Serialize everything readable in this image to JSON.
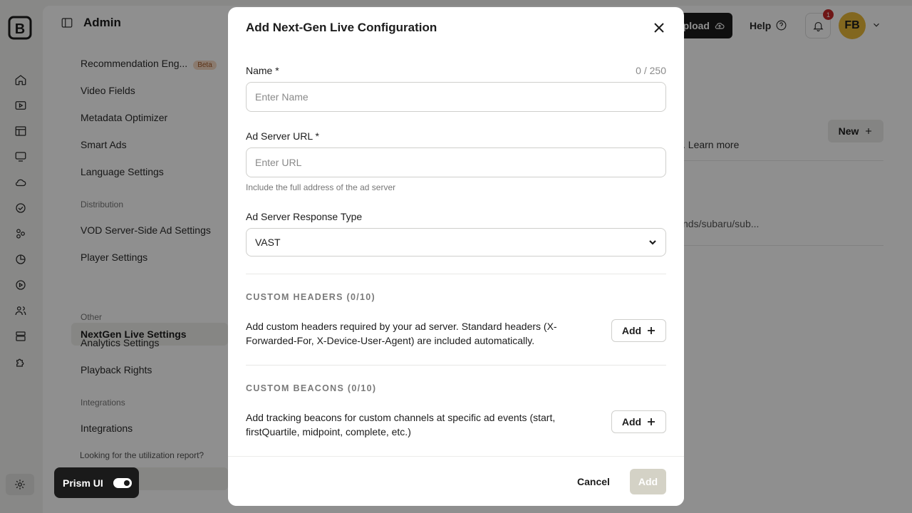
{
  "app": {
    "title": "Admin",
    "upload_label": "Upload",
    "help_label": "Help",
    "notification_count": "1",
    "avatar_initials": "FB",
    "new_label": "New",
    "learn_more_text": ". Learn more",
    "bg_url_fragment": "nds/subaru/sub..."
  },
  "sidebar": {
    "items": [
      {
        "label": "Recommendation Eng...",
        "tag": "Beta"
      },
      {
        "label": "Video Fields"
      },
      {
        "label": "Metadata Optimizer"
      },
      {
        "label": "Smart Ads"
      },
      {
        "label": "Language Settings"
      }
    ],
    "distribution_heading": "Distribution",
    "distribution_items": [
      {
        "label": "VOD Server-Side Ad Settings"
      },
      {
        "label": "Player Settings"
      },
      {
        "label": "NextGen Live Settings"
      }
    ],
    "other_heading": "Other",
    "other_items": [
      {
        "label": "Analytics Settings"
      },
      {
        "label": "Playback Rights"
      }
    ],
    "integrations_heading": "Integrations",
    "integrations_items": [
      {
        "label": "Integrations"
      }
    ],
    "utilization_text": "Looking for the utilization report?"
  },
  "prism": {
    "label": "Prism UI",
    "enabled": true
  },
  "modal": {
    "title": "Add Next-Gen Live Configuration",
    "name_label": "Name *",
    "name_count": "0 / 250",
    "name_placeholder": "Enter Name",
    "name_value": "",
    "url_label": "Ad Server URL *",
    "url_placeholder": "Enter URL",
    "url_value": "",
    "url_helper": "Include the full address of the ad server",
    "response_type_label": "Ad Server Response Type",
    "response_type_value": "VAST",
    "headers_title": "CUSTOM HEADERS (0/10)",
    "headers_desc": "Add custom headers required by your ad server. Standard headers (X-Forwarded-For, X-Device-User-Agent) are included automatically.",
    "headers_add_label": "Add",
    "beacons_title": "CUSTOM BEACONS (0/10)",
    "beacons_desc": "Add tracking beacons for custom channels at specific ad events (start, firstQuartile, midpoint, complete, etc.)",
    "beacons_add_label": "Add",
    "cancel_label": "Cancel",
    "submit_label": "Add"
  },
  "colors": {
    "overlay": "#000000",
    "avatar_bg": "#e8b838",
    "badge": "#c62828",
    "submit_disabled": "#d4d2c6"
  }
}
